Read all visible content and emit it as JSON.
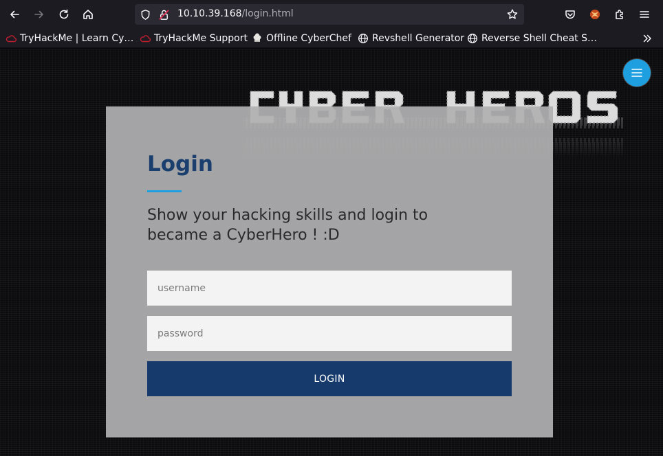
{
  "browser": {
    "url_host": "10.10.39.168",
    "url_path": "/login.html",
    "icons": {
      "back": "arrow-left-icon",
      "forward": "arrow-right-icon",
      "reload": "reload-icon",
      "home": "home-icon",
      "shield": "shield-icon",
      "insecure": "insecure-lock-icon",
      "bookmark": "star-icon",
      "pocket": "pocket-icon",
      "extension": "extension-icon",
      "puzzle": "puzzle-icon",
      "menu": "menu-icon"
    }
  },
  "bookmarks": [
    {
      "label": "TryHackMe | Learn Cy…",
      "icon": "tryhackme-icon"
    },
    {
      "label": "TryHackMe Support",
      "icon": "tryhackme-icon"
    },
    {
      "label": "Offline CyberChef",
      "icon": "chef-icon"
    },
    {
      "label": "Revshell Generator",
      "icon": "globe-icon"
    },
    {
      "label": "Reverse Shell Cheat S…",
      "icon": "globe-icon"
    }
  ],
  "page": {
    "logo_text": "CYBER HEROS",
    "login": {
      "title": "Login",
      "subtitle": "Show your hacking skills and login to became a CyberHero ! :D",
      "username_placeholder": "username",
      "password_placeholder": "password",
      "button_label": "LOGIN"
    }
  },
  "colors": {
    "accent": "#1d9fe0",
    "title": "#1a3e6e",
    "button": "#163a6b",
    "card": "#b0b0b2"
  }
}
